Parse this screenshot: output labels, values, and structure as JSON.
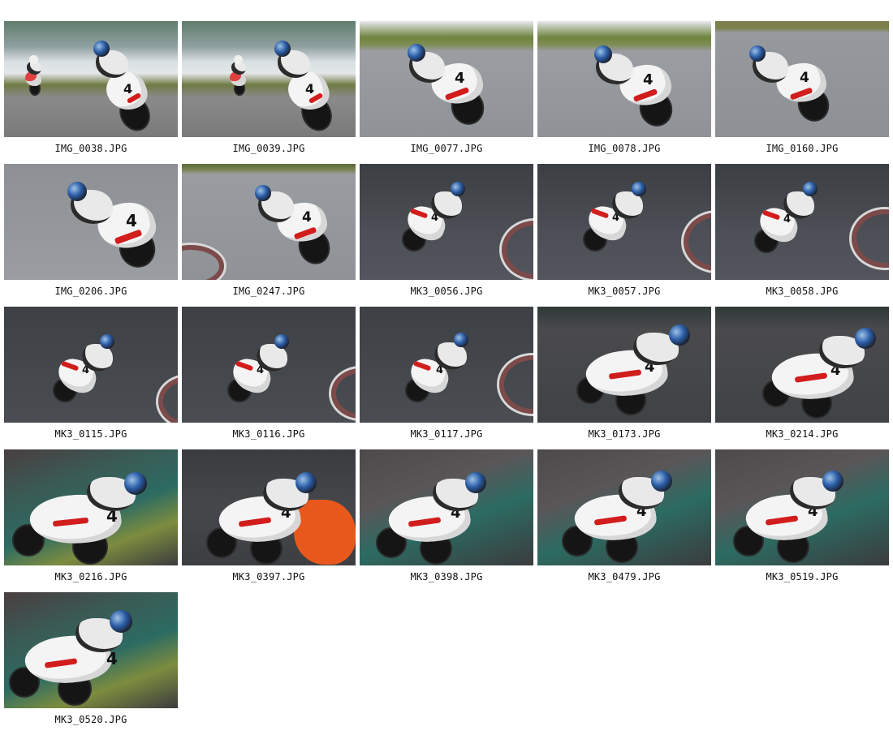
{
  "gallery": {
    "thumbnails": [
      {
        "filename": "IMG_0038.JPG"
      },
      {
        "filename": "IMG_0039.JPG"
      },
      {
        "filename": "IMG_0077.JPG"
      },
      {
        "filename": "IMG_0078.JPG"
      },
      {
        "filename": "IMG_0160.JPG"
      },
      {
        "filename": "IMG_0206.JPG"
      },
      {
        "filename": "IMG_0247.JPG"
      },
      {
        "filename": "MK3_0056.JPG"
      },
      {
        "filename": "MK3_0057.JPG"
      },
      {
        "filename": "MK3_0058.JPG"
      },
      {
        "filename": "MK3_0115.JPG"
      },
      {
        "filename": "MK3_0116.JPG"
      },
      {
        "filename": "MK3_0117.JPG"
      },
      {
        "filename": "MK3_0173.JPG"
      },
      {
        "filename": "MK3_0214.JPG"
      },
      {
        "filename": "MK3_0216.JPG"
      },
      {
        "filename": "MK3_0397.JPG"
      },
      {
        "filename": "MK3_0398.JPG"
      },
      {
        "filename": "MK3_0479.JPG"
      },
      {
        "filename": "MK3_0519.JPG"
      },
      {
        "filename": "MK3_0520.JPG"
      }
    ]
  }
}
